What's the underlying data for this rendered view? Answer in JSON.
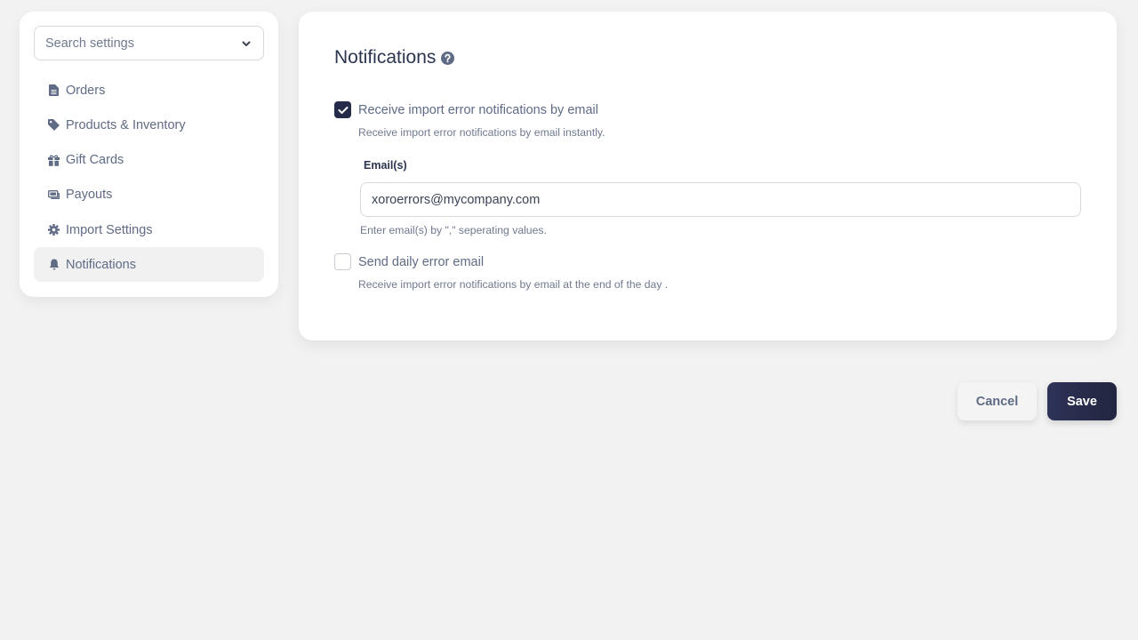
{
  "sidebar": {
    "search_placeholder": "Search settings",
    "items": [
      {
        "label": "Orders",
        "icon": "document-icon",
        "active": false
      },
      {
        "label": "Products & Inventory",
        "icon": "tag-icon",
        "active": false
      },
      {
        "label": "Gift Cards",
        "icon": "gift-icon",
        "active": false
      },
      {
        "label": "Payouts",
        "icon": "money-icon",
        "active": false
      },
      {
        "label": "Import Settings",
        "icon": "gear-icon",
        "active": false
      },
      {
        "label": "Notifications",
        "icon": "bell-icon",
        "active": true
      }
    ]
  },
  "main": {
    "title": "Notifications",
    "options": [
      {
        "label": "Receive import error notifications by email",
        "checked": true,
        "description": "Receive import error notifications by email instantly."
      },
      {
        "label": "Send daily error email",
        "checked": false,
        "description": "Receive import error notifications by email at the end of the day ."
      }
    ],
    "email": {
      "label": "Email(s)",
      "value": "xoroerrors@mycompany.com",
      "hint": "Enter email(s) by \",\" seperating values."
    }
  },
  "actions": {
    "cancel_label": "Cancel",
    "save_label": "Save"
  },
  "colors": {
    "accent": "#262b4a",
    "text": "#5f6b85",
    "heading": "#2b3550"
  }
}
